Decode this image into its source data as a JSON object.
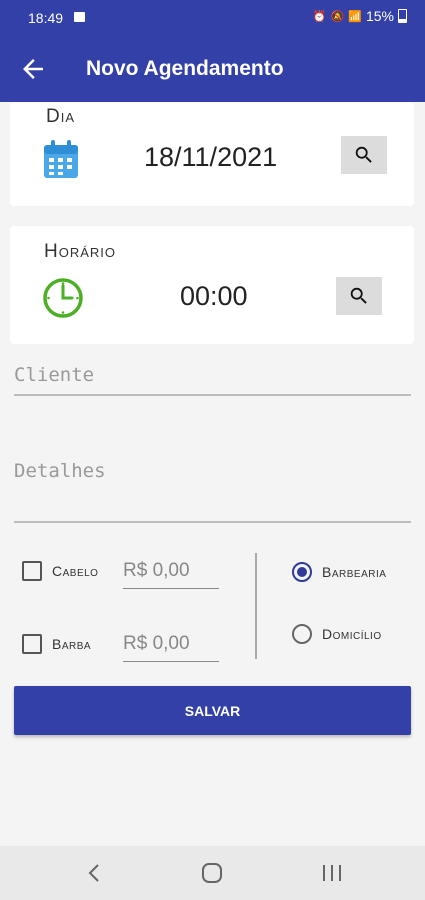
{
  "status_bar": {
    "time": "18:49",
    "battery": "15%"
  },
  "app_bar": {
    "title": "Novo Agendamento"
  },
  "date_card": {
    "label": "Dia",
    "value": "18/11/2021"
  },
  "time_card": {
    "label": "Horário",
    "value": "00:00"
  },
  "form": {
    "client_placeholder": "Cliente",
    "details_placeholder": "Detalhes"
  },
  "services": [
    {
      "label": "Cabelo",
      "price": "R$ 0,00",
      "checked": false
    },
    {
      "label": "Barba",
      "price": "R$ 0,00",
      "checked": false
    }
  ],
  "location": {
    "options": [
      {
        "label": "Barbearia",
        "selected": true
      },
      {
        "label": "Domicílio",
        "selected": false
      }
    ]
  },
  "save_label": "SALVAR",
  "colors": {
    "primary": "#3240a8",
    "calendar_icon": "#4aa8e8",
    "clock_icon": "#4caf26"
  }
}
